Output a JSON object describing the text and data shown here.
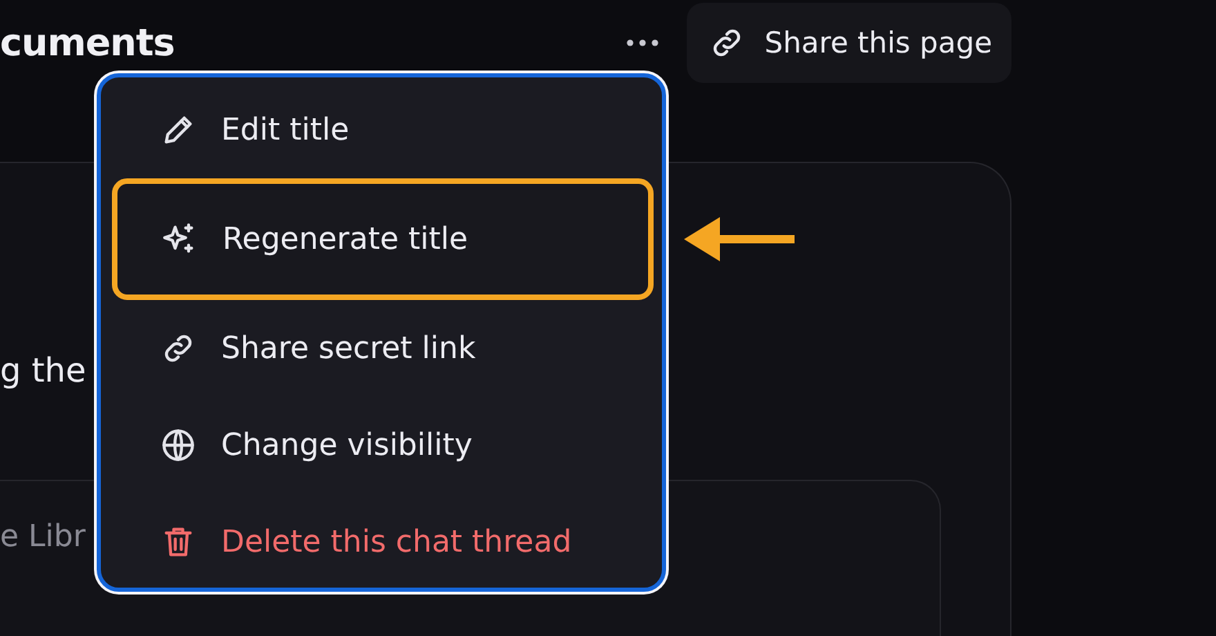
{
  "page": {
    "title": "cuments",
    "body_text": "g the",
    "field_placeholder": "e Libr"
  },
  "share_button": {
    "label": "Share this page"
  },
  "menu": {
    "items": [
      {
        "label": "Edit title",
        "kind": "edit",
        "selected": false
      },
      {
        "label": "Regenerate title",
        "kind": "regenerate",
        "selected": true
      },
      {
        "label": "Share secret link",
        "kind": "link",
        "selected": false
      },
      {
        "label": "Change visibility",
        "kind": "visibility",
        "selected": false
      },
      {
        "label": "Delete this chat thread",
        "kind": "delete",
        "selected": false
      }
    ]
  }
}
